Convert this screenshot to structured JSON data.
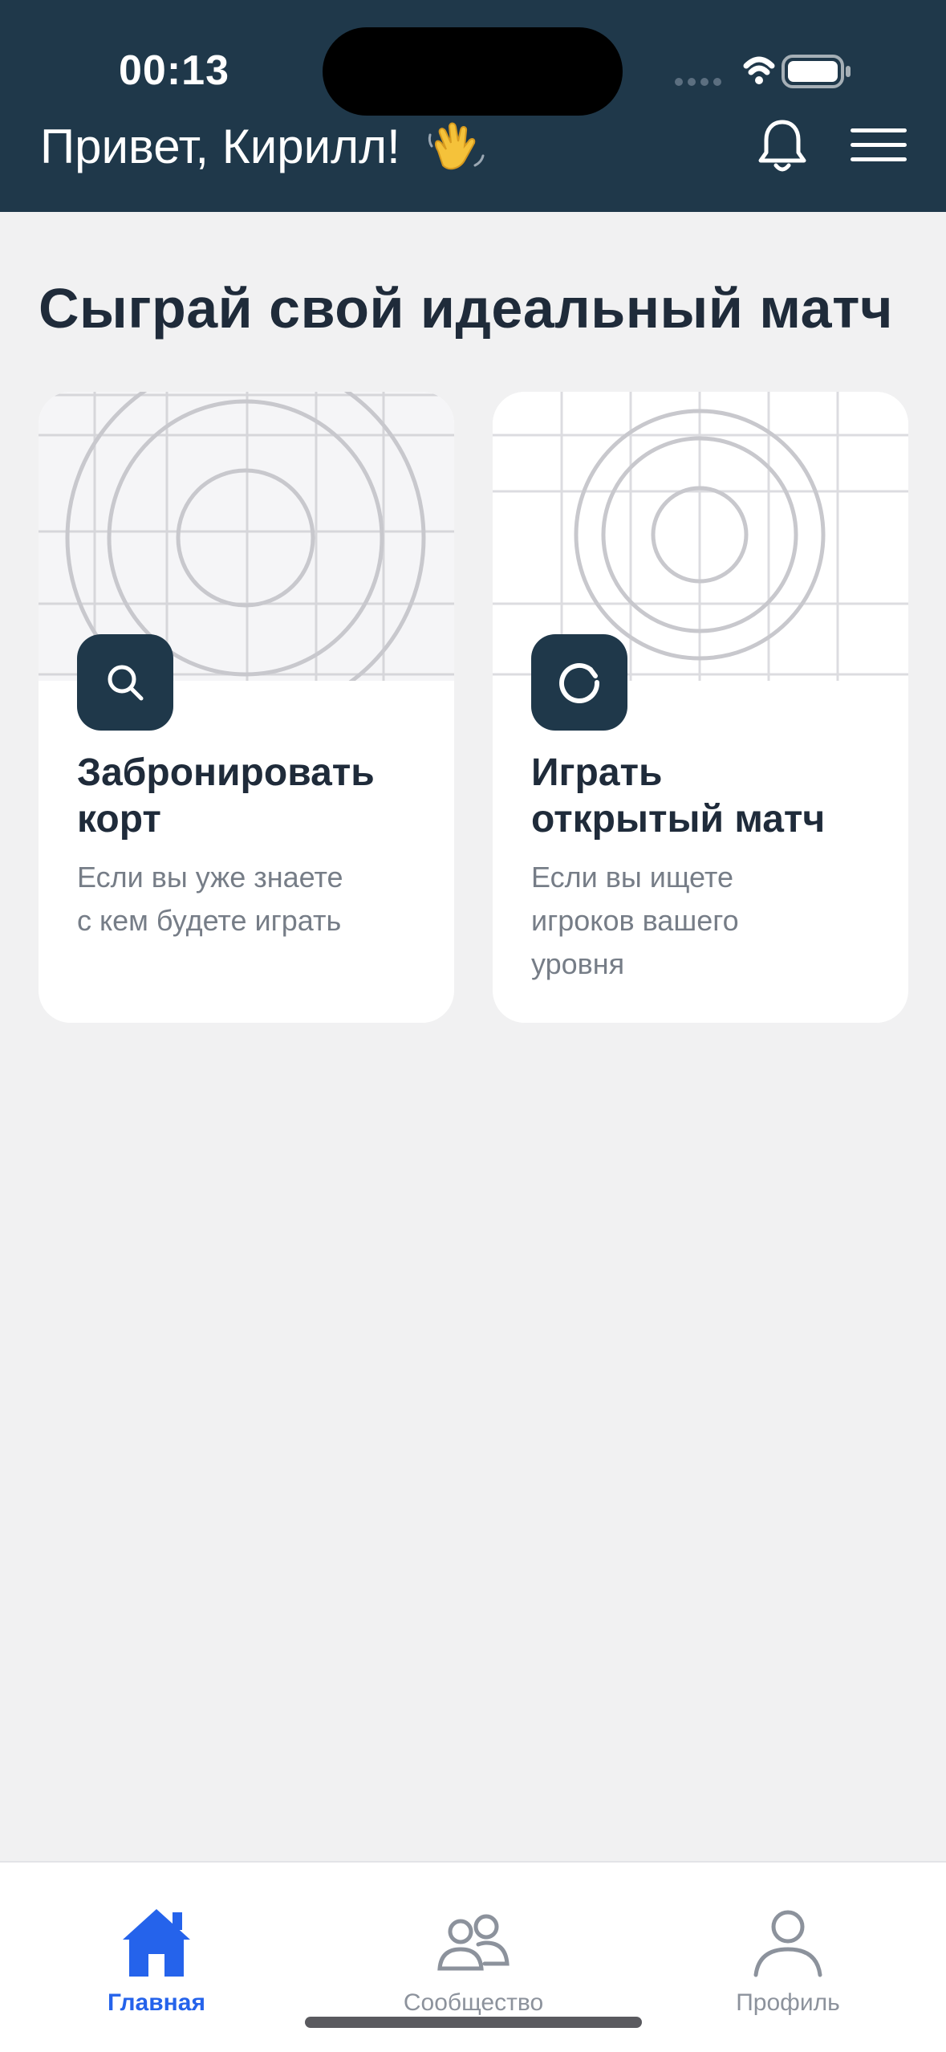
{
  "status_bar": {
    "time": "00:13"
  },
  "header": {
    "greeting": "Привет, Кирилл!",
    "greeting_emoji_icon": "waving-hand-icon",
    "notifications_icon": "bell-icon",
    "menu_icon": "hamburger-menu-icon"
  },
  "main": {
    "title": "Сыграй свой идеальный матч",
    "cards": [
      {
        "icon": "search-icon",
        "title_lines": [
          "Забронировать",
          "корт"
        ],
        "description_lines": [
          "Если вы уже знаете",
          "с кем будете играть"
        ]
      },
      {
        "icon": "refresh-circle-icon",
        "title_lines": [
          "Играть",
          "открытый матч"
        ],
        "description_lines": [
          "Если вы ищете",
          "игроков вашего",
          "уровня"
        ]
      }
    ]
  },
  "tabbar": {
    "active_color": "#2563eb",
    "inactive_color": "#8c929c",
    "tabs": [
      {
        "label": "Главная",
        "icon": "home-icon",
        "active": true
      },
      {
        "label": "Сообщество",
        "icon": "community-icon",
        "active": false
      },
      {
        "label": "Профиль",
        "icon": "profile-icon",
        "active": false
      }
    ]
  },
  "colors": {
    "header_bg": "#1f384a",
    "page_bg": "#f1f1f2",
    "card_bg": "#ffffff",
    "text_primary": "#1f2b3a",
    "text_secondary": "#767d87"
  }
}
